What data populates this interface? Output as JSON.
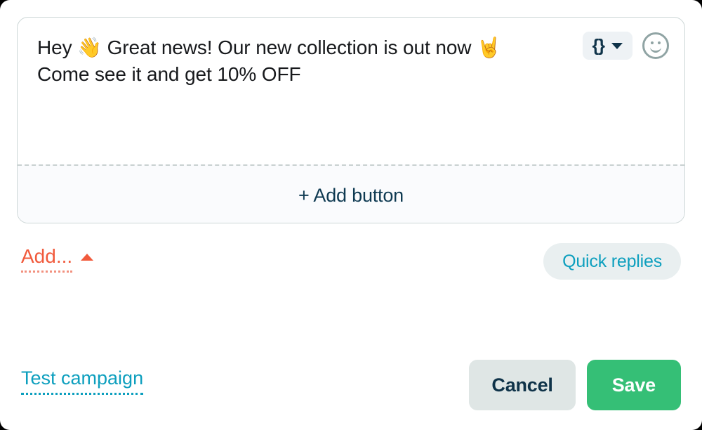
{
  "composer": {
    "message_text": "Hey 👋 Great news! Our new collection is out now 🤘\nCome see it and get 10% OFF",
    "variable_button": {
      "label": "{}",
      "icon": "chevron-down-icon"
    },
    "emoji_button": {
      "icon": "emoji-smiley-icon"
    },
    "add_button_label": "+ Add button"
  },
  "secondary": {
    "add_link_label": "Add...",
    "add_link_caret": "caret-up-icon",
    "quick_replies_label": "Quick replies"
  },
  "footer": {
    "test_campaign_label": "Test campaign",
    "cancel_label": "Cancel",
    "save_label": "Save"
  },
  "colors": {
    "accent_orange": "#f15a3c",
    "accent_teal": "#0d9fbe",
    "accent_green": "#35bf76",
    "navy": "#0f3349",
    "card_border": "#cdd7d7",
    "cancel_bg": "#dfe6e5",
    "quick_replies_bg": "#e9eff0",
    "add_zone_bg": "#fafbfd"
  }
}
